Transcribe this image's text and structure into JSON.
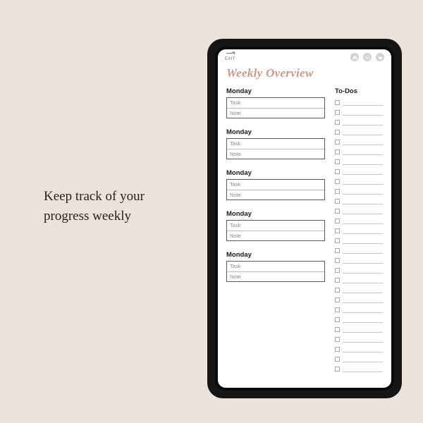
{
  "tagline_line1": "Keep track of your",
  "tagline_line2": "progress weekly",
  "exit_label": "EXIT",
  "page_title": "Weekly Overview",
  "todos_heading": "To-Dos",
  "todo_count": 28,
  "days": [
    {
      "label": "Monday",
      "task": "Task",
      "note": "Note"
    },
    {
      "label": "Monday",
      "task": "Task",
      "note": "Note"
    },
    {
      "label": "Monday",
      "task": "Task",
      "note": "Note"
    },
    {
      "label": "Monday",
      "task": "Task",
      "note": "Note"
    },
    {
      "label": "Monday",
      "task": "Task",
      "note": "Note"
    }
  ],
  "icons": {
    "home": "home-icon",
    "target": "target-icon",
    "calendar": "calendar-icon"
  },
  "colors": {
    "background": "#ebe3db",
    "accent": "#c99b8e",
    "tablet": "#161616"
  }
}
